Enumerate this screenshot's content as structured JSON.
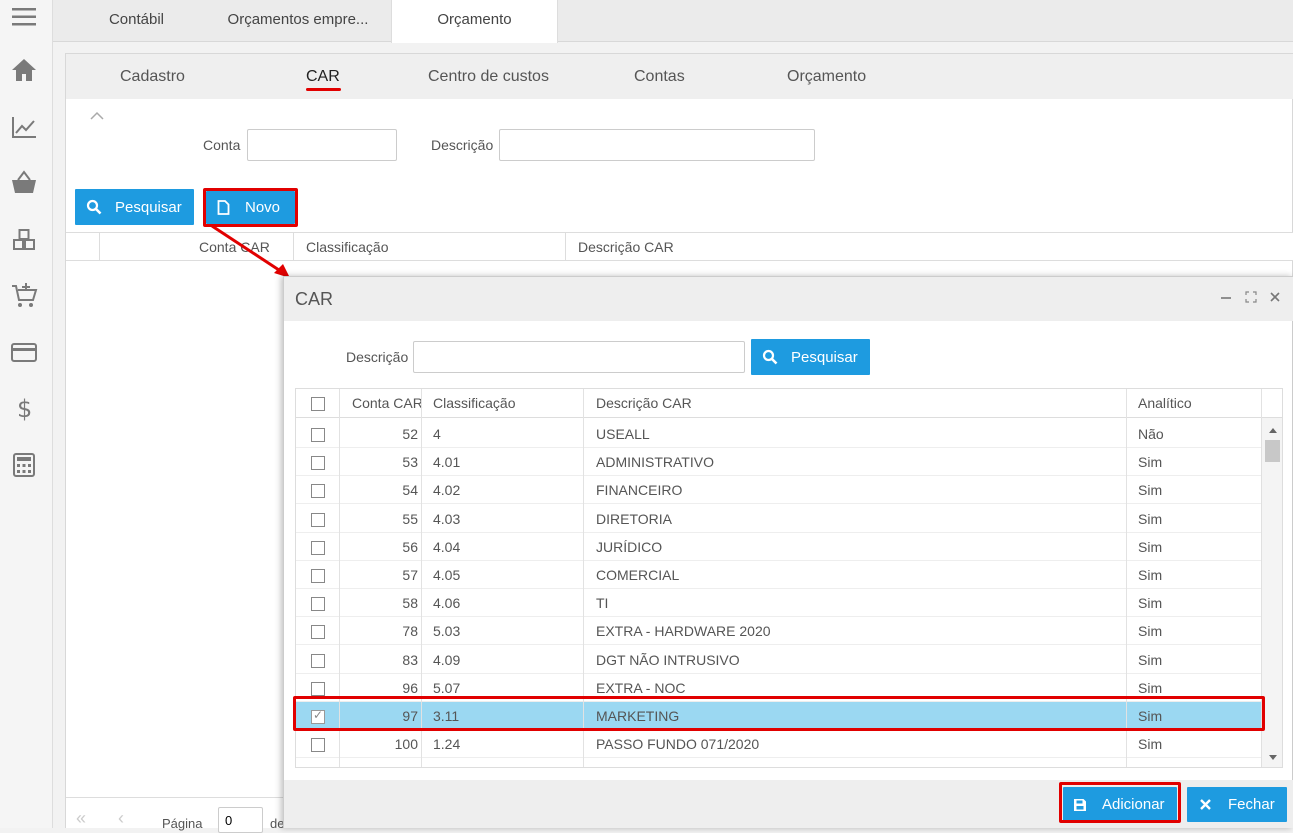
{
  "top_tabs": [
    {
      "label": "Contábil"
    },
    {
      "label": "Orçamentos empre..."
    },
    {
      "label": "Orçamento"
    }
  ],
  "sub_tabs": [
    {
      "label": "Cadastro"
    },
    {
      "label": "CAR"
    },
    {
      "label": "Centro de custos"
    },
    {
      "label": "Contas"
    },
    {
      "label": "Orçamento"
    }
  ],
  "filter": {
    "conta_label": "Conta",
    "conta_value": "",
    "descricao_label": "Descrição",
    "descricao_value": "",
    "search_label": "Pesquisar",
    "new_label": "Novo"
  },
  "background_grid": {
    "columns": [
      "Conta CAR",
      "Classificação",
      "Descrição CAR"
    ]
  },
  "pager": {
    "page_label": "Página",
    "page_value": "0",
    "of_label": "de"
  },
  "dialog": {
    "title": "CAR",
    "descricao_label": "Descrição",
    "descricao_value": "",
    "search_label": "Pesquisar",
    "columns": [
      "Conta CAR",
      "Classificação",
      "Descrição CAR",
      "Analítico"
    ],
    "rows": [
      {
        "conta": "52",
        "classificacao": "4",
        "descricao": "USEALL",
        "analitico": "Não",
        "checked": false
      },
      {
        "conta": "53",
        "classificacao": "4.01",
        "descricao": "ADMINISTRATIVO",
        "analitico": "Sim",
        "checked": false
      },
      {
        "conta": "54",
        "classificacao": "4.02",
        "descricao": "FINANCEIRO",
        "analitico": "Sim",
        "checked": false
      },
      {
        "conta": "55",
        "classificacao": "4.03",
        "descricao": "DIRETORIA",
        "analitico": "Sim",
        "checked": false
      },
      {
        "conta": "56",
        "classificacao": "4.04",
        "descricao": "JURÍDICO",
        "analitico": "Sim",
        "checked": false
      },
      {
        "conta": "57",
        "classificacao": "4.05",
        "descricao": "COMERCIAL",
        "analitico": "Sim",
        "checked": false
      },
      {
        "conta": "58",
        "classificacao": "4.06",
        "descricao": "TI",
        "analitico": "Sim",
        "checked": false
      },
      {
        "conta": "78",
        "classificacao": "5.03",
        "descricao": "EXTRA - HARDWARE 2020",
        "analitico": "Sim",
        "checked": false
      },
      {
        "conta": "83",
        "classificacao": "4.09",
        "descricao": "DGT NÃO INTRUSIVO",
        "analitico": "Sim",
        "checked": false
      },
      {
        "conta": "96",
        "classificacao": "5.07",
        "descricao": "EXTRA - NOC",
        "analitico": "Sim",
        "checked": false
      },
      {
        "conta": "97",
        "classificacao": "3.11",
        "descricao": "MARKETING",
        "analitico": "Sim",
        "checked": true
      },
      {
        "conta": "100",
        "classificacao": "1.24",
        "descricao": "PASSO FUNDO 071/2020",
        "analitico": "Sim",
        "checked": false
      }
    ],
    "add_label": "Adicionar",
    "close_label": "Fechar"
  },
  "colors": {
    "accent": "#1e9be0",
    "highlight": "#e10000",
    "selected_row": "#9bd8f2"
  }
}
